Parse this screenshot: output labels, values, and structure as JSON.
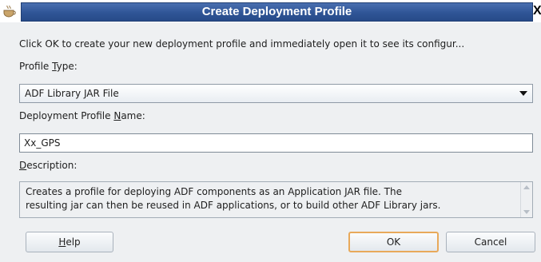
{
  "window": {
    "title": "Create Deployment Profile",
    "close_glyph": "X",
    "app_icon": "coffee-cup-icon"
  },
  "intro_text": "Click OK to create your new deployment profile and immediately open it to see its configur...",
  "profile_type": {
    "label_before": "Profile ",
    "label_mnemonic": "T",
    "label_after": "ype:",
    "value": "ADF Library JAR File"
  },
  "profile_name": {
    "label_before": "Deployment Profile ",
    "label_mnemonic": "N",
    "label_after": "ame:",
    "value": "Xx_GPS"
  },
  "description": {
    "label_before": "",
    "label_mnemonic": "D",
    "label_after": "escription:",
    "line1": "Creates a profile for deploying ADF components as an Application JAR file. The",
    "line2": "resulting jar can then be reused in ADF applications, or to build other ADF Library jars."
  },
  "buttons": {
    "help_mnemonic": "H",
    "help_rest": "elp",
    "ok": "OK",
    "cancel": "Cancel"
  },
  "colors": {
    "title_bar": "#2f5596",
    "ok_focus_border": "#e8a95a",
    "dialog_bg": "#eef0f2"
  }
}
